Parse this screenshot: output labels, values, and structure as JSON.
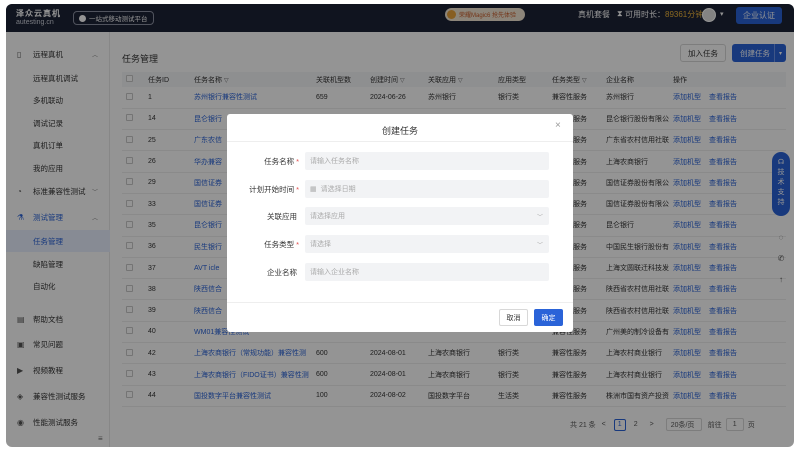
{
  "topbar": {
    "logo_line1": "泽众云真机",
    "logo_line2": "autesting.cn",
    "platform_label": "一站式移动测试平台",
    "promo_text": "荣耀Magic6 抢先体验",
    "menu_real_device_plan": "真机套餐",
    "duration_label": "可用时长：",
    "duration_value": "89361分钟",
    "cert_button": "企业认证"
  },
  "sidebar": {
    "items": [
      {
        "icon": "device-icon",
        "label": "远程真机",
        "caret": "^"
      },
      {
        "label": "远程真机调试"
      },
      {
        "label": "多机联动"
      },
      {
        "label": "调试记录"
      },
      {
        "label": "真机订单"
      },
      {
        "label": "我的应用"
      },
      {
        "icon": "gauge-icon",
        "label": "标准兼容性测试",
        "caret": "v"
      },
      {
        "icon": "flask-icon",
        "label": "测试管理",
        "caret": "^"
      },
      {
        "label": "任务管理"
      },
      {
        "label": "缺陷管理"
      },
      {
        "label": "自动化"
      },
      {
        "icon": "doc-icon",
        "label": "帮助文档"
      },
      {
        "icon": "question-icon",
        "label": "常见问题"
      },
      {
        "icon": "video-icon",
        "label": "视频教程"
      },
      {
        "icon": "service-icon",
        "label": "兼容性测试服务"
      },
      {
        "icon": "chart-icon",
        "label": "性能测试服务"
      }
    ]
  },
  "main": {
    "page_title": "任务管理",
    "add_task_button": "加入任务",
    "create_task_button": "创建任务",
    "table": {
      "headers": [
        "任务ID",
        "任务名称",
        "关联机型数",
        "创建时间",
        "关联应用",
        "应用类型",
        "任务类型",
        "企业名称",
        "操作"
      ],
      "rows": [
        {
          "id": "1",
          "name": "苏州银行兼容性测试",
          "count": "659",
          "date": "2024-06-26",
          "app": "苏州银行",
          "app_type": "银行类",
          "task_type": "兼容性服务",
          "company": "苏州银行"
        },
        {
          "id": "14",
          "name": "昆仑银行",
          "count": "",
          "date": "",
          "app": "",
          "app_type": "",
          "task_type": "兼容性服务",
          "company": "昆仑银行股份有限公"
        },
        {
          "id": "25",
          "name": "广东农信",
          "count": "",
          "date": "",
          "app": "",
          "app_type": "",
          "task_type": "兼容性服务",
          "company": "广东省农村信用社联"
        },
        {
          "id": "26",
          "name": "华办兼容",
          "count": "",
          "date": "",
          "app": "",
          "app_type": "",
          "task_type": "兼容性服务",
          "company": "上海农商银行"
        },
        {
          "id": "29",
          "name": "国信证券",
          "count": "",
          "date": "",
          "app": "",
          "app_type": "",
          "task_type": "兼容性服务",
          "company": "国信证券股份有限公"
        },
        {
          "id": "33",
          "name": "国信证券",
          "count": "",
          "date": "",
          "app": "",
          "app_type": "",
          "task_type": "兼容性服务",
          "company": "国信证券股份有限公"
        },
        {
          "id": "35",
          "name": "昆仑银行",
          "count": "",
          "date": "",
          "app": "",
          "app_type": "",
          "task_type": "兼容性服务",
          "company": "昆仑银行"
        },
        {
          "id": "36",
          "name": "民生银行",
          "count": "",
          "date": "",
          "app": "",
          "app_type": "",
          "task_type": "兼容性服务",
          "company": "中国民生银行股份有"
        },
        {
          "id": "37",
          "name": "AVT icle",
          "count": "",
          "date": "",
          "app": "",
          "app_type": "",
          "task_type": "兼容性服务",
          "company": "上海文圆联迁科技发"
        },
        {
          "id": "38",
          "name": "陕西信合",
          "count": "",
          "date": "",
          "app": "",
          "app_type": "",
          "task_type": "兼容性服务",
          "company": "陕西省农村信用社联"
        },
        {
          "id": "39",
          "name": "陕西信合",
          "count": "",
          "date": "",
          "app": "",
          "app_type": "",
          "task_type": "兼容性服务",
          "company": "陕西省农村信用社联"
        },
        {
          "id": "40",
          "name": "WM01兼容性测试",
          "count": "",
          "date": "",
          "app": "",
          "app_type": "",
          "task_type": "兼容性服务",
          "company": "广州美的制冷设备有"
        },
        {
          "id": "42",
          "name": "上海农商银行（常规功能）兼容性测",
          "count": "600",
          "date": "2024-08-01",
          "app": "上海农商银行",
          "app_type": "银行类",
          "task_type": "兼容性服务",
          "company": "上海农村商业银行"
        },
        {
          "id": "43",
          "name": "上海农商银行（FIDO证书）兼容性测",
          "count": "600",
          "date": "2024-08-01",
          "app": "上海农商银行",
          "app_type": "银行类",
          "task_type": "兼容性服务",
          "company": "上海农村商业银行"
        },
        {
          "id": "44",
          "name": "国投数字平台兼容性测试",
          "count": "100",
          "date": "2024-08-02",
          "app": "国投数字平台",
          "app_type": "生活类",
          "task_type": "兼容性服务",
          "company": "株洲市国有资产投资"
        }
      ],
      "op_add_model": "添加机型",
      "op_view_report": "查看报告"
    },
    "pagination": {
      "total": "共 21 条",
      "prev": "<",
      "page1": "1",
      "page2": "2",
      "next": ">",
      "page_size": "20条/页",
      "goto_label": "前往",
      "goto_value": "1",
      "page_unit": "页"
    }
  },
  "float_panel": {
    "support": "技术支持"
  },
  "modal": {
    "title": "创建任务",
    "fields": [
      {
        "label": "任务名称",
        "required": "*",
        "placeholder": "请输入任务名称"
      },
      {
        "label": "计划开始时间",
        "required": "*",
        "placeholder": "请选择日期"
      },
      {
        "label": "关联应用",
        "required": "",
        "placeholder": "请选择应用"
      },
      {
        "label": "任务类型",
        "required": "*",
        "placeholder": "请选择"
      },
      {
        "label": "企业名称",
        "required": "",
        "placeholder": "请输入企业名称"
      }
    ],
    "cancel": "取消",
    "ok": "确定"
  },
  "colors": {
    "primary": "#2a63d8",
    "topbar": "#1d2336",
    "duration": "#f0b63a",
    "required": "#e24b4b"
  }
}
